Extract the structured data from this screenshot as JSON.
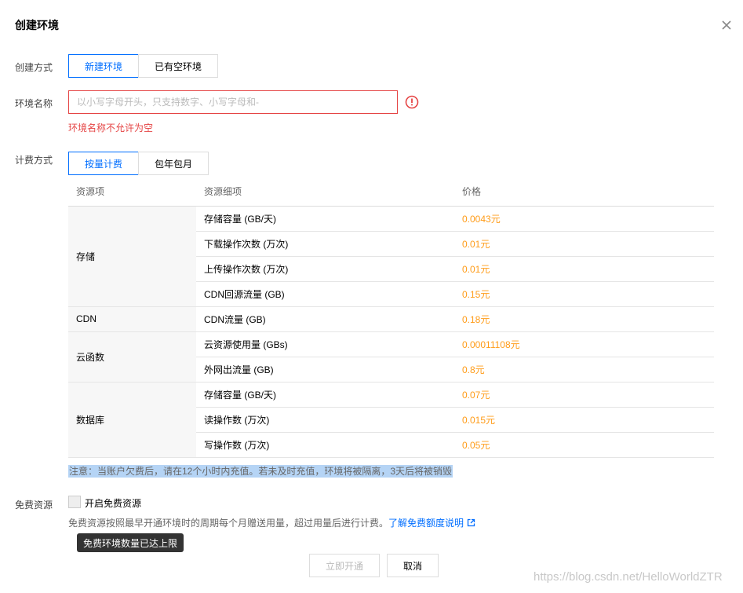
{
  "dialog": {
    "title": "创建环境"
  },
  "create_mode": {
    "label": "创建方式",
    "options": [
      "新建环境",
      "已有空环境"
    ],
    "selected": "新建环境"
  },
  "env_name": {
    "label": "环境名称",
    "placeholder": "以小写字母开头，只支持数字、小写字母和-",
    "value": "",
    "error": "环境名称不允许为空"
  },
  "billing": {
    "label": "计费方式",
    "options": [
      "按量计费",
      "包年包月"
    ],
    "selected": "按量计费"
  },
  "price_table": {
    "headers": [
      "资源项",
      "资源细项",
      "价格"
    ],
    "groups": [
      {
        "name": "存储",
        "rows": [
          {
            "detail": "存储容量 (GB/天)",
            "price": "0.0043元"
          },
          {
            "detail": "下载操作次数 (万次)",
            "price": "0.01元"
          },
          {
            "detail": "上传操作次数 (万次)",
            "price": "0.01元"
          },
          {
            "detail": "CDN回源流量 (GB)",
            "price": "0.15元"
          }
        ]
      },
      {
        "name": "CDN",
        "rows": [
          {
            "detail": "CDN流量 (GB)",
            "price": "0.18元"
          }
        ]
      },
      {
        "name": "云函数",
        "rows": [
          {
            "detail": "云资源使用量 (GBs)",
            "price": "0.00011108元"
          },
          {
            "detail": "外网出流量 (GB)",
            "price": "0.8元"
          }
        ]
      },
      {
        "name": "数据库",
        "rows": [
          {
            "detail": "存储容量 (GB/天)",
            "price": "0.07元"
          },
          {
            "detail": "读操作数 (万次)",
            "price": "0.015元"
          },
          {
            "detail": "写操作数 (万次)",
            "price": "0.05元"
          }
        ]
      }
    ]
  },
  "notice": "注意：当账户欠费后，请在12个小时内充值。若未及时充值，环境将被隔离，3天后将被销毁",
  "free_resources": {
    "label": "免费资源",
    "checkbox_label": "开启免费资源",
    "checked": false,
    "description": "免费资源按照最早开通环境时的周期每个月赠送用量，超过用量后进行计费。",
    "link_text": "了解免费额度说明",
    "tooltip": "免费环境数量已达上限"
  },
  "actions": {
    "submit_label": "立即开通",
    "submit_disabled": true,
    "cancel_label": "取消"
  },
  "watermark": "https://blog.csdn.net/HelloWorldZTR",
  "colors": {
    "accent": "#006eff",
    "error": "#e54545",
    "price": "#ff9c19",
    "notice_highlight": "#b5d4f5"
  },
  "icons": {
    "close": "close-icon",
    "error": "exclamation-circle-icon",
    "external_link": "external-link-icon"
  }
}
